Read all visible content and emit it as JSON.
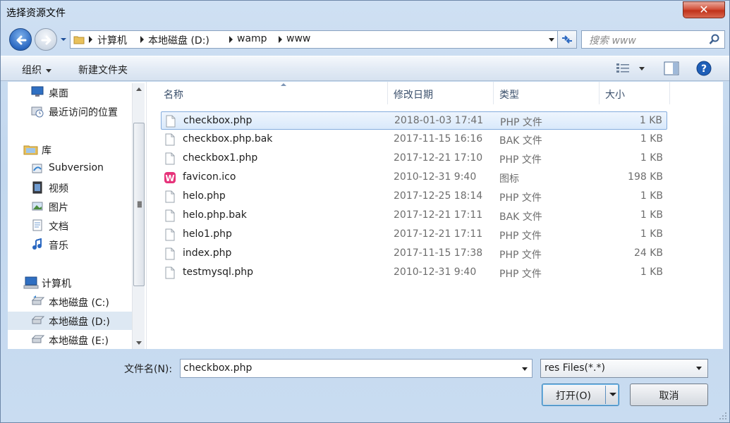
{
  "window": {
    "title": "选择资源文件",
    "close_label": "✕"
  },
  "address": {
    "crumbs": [
      "计算机",
      "本地磁盘 (D:)",
      "wamp",
      "www"
    ]
  },
  "search": {
    "placeholder": "搜索 www"
  },
  "toolbar": {
    "organize": "组织",
    "new_folder": "新建文件夹"
  },
  "nav": {
    "items": [
      {
        "label": "桌面",
        "icon": "desktop-icon"
      },
      {
        "label": "最近访问的位置",
        "icon": "recent-places-icon"
      },
      {
        "label": "库",
        "icon": "library-icon"
      },
      {
        "label": "Subversion",
        "icon": "subversion-icon"
      },
      {
        "label": "视频",
        "icon": "video-icon"
      },
      {
        "label": "图片",
        "icon": "pictures-icon"
      },
      {
        "label": "文档",
        "icon": "documents-icon"
      },
      {
        "label": "音乐",
        "icon": "music-icon"
      },
      {
        "label": "计算机",
        "icon": "computer-icon"
      },
      {
        "label": "本地磁盘 (C:)",
        "icon": "drive-c-icon"
      },
      {
        "label": "本地磁盘 (D:)",
        "icon": "drive-d-icon",
        "selected": true
      },
      {
        "label": "本地磁盘 (E:)",
        "icon": "drive-e-icon"
      }
    ]
  },
  "columns": {
    "name": "名称",
    "modified": "修改日期",
    "type": "类型",
    "size": "大小"
  },
  "files": [
    {
      "name": "checkbox.php",
      "modified": "2018-01-03 17:41",
      "type": "PHP 文件",
      "size": "1 KB",
      "selected": true,
      "icon": "file-icon"
    },
    {
      "name": "checkbox.php.bak",
      "modified": "2017-11-15 16:16",
      "type": "BAK 文件",
      "size": "1 KB",
      "icon": "file-icon"
    },
    {
      "name": "checkbox1.php",
      "modified": "2017-12-21 17:10",
      "type": "PHP 文件",
      "size": "1 KB",
      "icon": "file-icon"
    },
    {
      "name": "favicon.ico",
      "modified": "2010-12-31 9:40",
      "type": "图标",
      "size": "198 KB",
      "icon": "wamp-icon"
    },
    {
      "name": "helo.php",
      "modified": "2017-12-25 18:14",
      "type": "PHP 文件",
      "size": "1 KB",
      "icon": "file-icon"
    },
    {
      "name": "helo.php.bak",
      "modified": "2017-12-21 17:11",
      "type": "BAK 文件",
      "size": "1 KB",
      "icon": "file-icon"
    },
    {
      "name": "helo1.php",
      "modified": "2017-12-21 17:11",
      "type": "PHP 文件",
      "size": "1 KB",
      "icon": "file-icon"
    },
    {
      "name": "index.php",
      "modified": "2017-11-15 17:38",
      "type": "PHP 文件",
      "size": "24 KB",
      "icon": "file-icon"
    },
    {
      "name": "testmysql.php",
      "modified": "2010-12-31 9:40",
      "type": "PHP 文件",
      "size": "1 KB",
      "icon": "file-icon"
    }
  ],
  "footer": {
    "filename_label": "文件名(N):",
    "filename_value": "checkbox.php",
    "filter_value": "res Files(*.*)",
    "open_label": "打开(O)",
    "cancel_label": "取消"
  },
  "colors": {
    "selection_border": "#84acdd",
    "selection_fill": "#d9e9fb",
    "chrome": "#c9dcf1"
  }
}
